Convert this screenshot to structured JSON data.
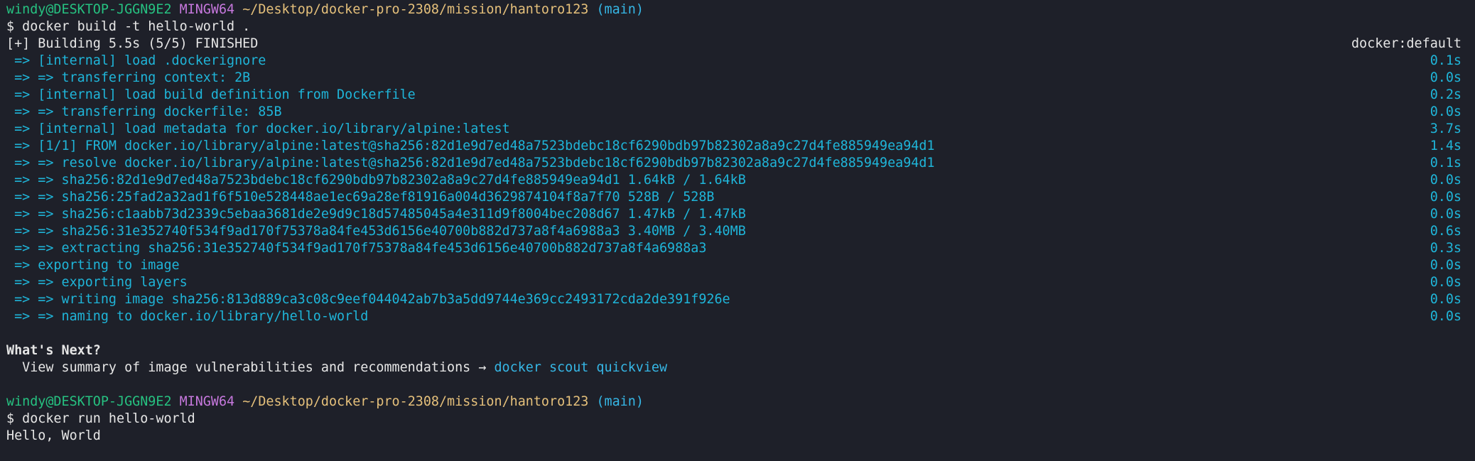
{
  "colors": {
    "background": "#1e2029",
    "user": "#26c281",
    "system": "#c678dd",
    "path": "#e5c07b",
    "branch": "#36b7e6",
    "step": "#1fb5d9",
    "text": "#e6e6e6"
  },
  "prompt1": {
    "user": "windy@DESKTOP-JGGN9E2",
    "system": "MINGW64",
    "path": "~/Desktop/docker-pro-2308/mission/hantoro123",
    "branch": "(main)"
  },
  "cmd1": "$ docker build -t hello-world .",
  "build_header": {
    "left": "[+] Building 5.5s (5/5) FINISHED",
    "right": "docker:default"
  },
  "steps": [
    {
      "text": " => [internal] load .dockerignore",
      "time": "0.1s"
    },
    {
      "text": " => => transferring context: 2B",
      "time": "0.0s"
    },
    {
      "text": " => [internal] load build definition from Dockerfile",
      "time": "0.2s"
    },
    {
      "text": " => => transferring dockerfile: 85B",
      "time": "0.0s"
    },
    {
      "text": " => [internal] load metadata for docker.io/library/alpine:latest",
      "time": "3.7s"
    },
    {
      "text": " => [1/1] FROM docker.io/library/alpine:latest@sha256:82d1e9d7ed48a7523bdebc18cf6290bdb97b82302a8a9c27d4fe885949ea94d1",
      "time": "1.4s"
    },
    {
      "text": " => => resolve docker.io/library/alpine:latest@sha256:82d1e9d7ed48a7523bdebc18cf6290bdb97b82302a8a9c27d4fe885949ea94d1",
      "time": "0.1s"
    },
    {
      "text": " => => sha256:82d1e9d7ed48a7523bdebc18cf6290bdb97b82302a8a9c27d4fe885949ea94d1 1.64kB / 1.64kB",
      "time": "0.0s"
    },
    {
      "text": " => => sha256:25fad2a32ad1f6f510e528448ae1ec69a28ef81916a004d3629874104f8a7f70 528B / 528B",
      "time": "0.0s"
    },
    {
      "text": " => => sha256:c1aabb73d2339c5ebaa3681de2e9d9c18d57485045a4e311d9f8004bec208d67 1.47kB / 1.47kB",
      "time": "0.0s"
    },
    {
      "text": " => => sha256:31e352740f534f9ad170f75378a84fe453d6156e40700b882d737a8f4a6988a3 3.40MB / 3.40MB",
      "time": "0.6s"
    },
    {
      "text": " => => extracting sha256:31e352740f534f9ad170f75378a84fe453d6156e40700b882d737a8f4a6988a3",
      "time": "0.3s"
    },
    {
      "text": " => exporting to image",
      "time": "0.0s"
    },
    {
      "text": " => => exporting layers",
      "time": "0.0s"
    },
    {
      "text": " => => writing image sha256:813d889ca3c08c9eef044042ab7b3a5dd9744e369cc2493172cda2de391f926e",
      "time": "0.0s"
    },
    {
      "text": " => => naming to docker.io/library/hello-world",
      "time": "0.0s"
    }
  ],
  "whats_next": {
    "heading": "What's Next?",
    "text": "  View summary of image vulnerabilities and recommendations → ",
    "link": "docker scout quickview"
  },
  "prompt2": {
    "user": "windy@DESKTOP-JGGN9E2",
    "system": "MINGW64",
    "path": "~/Desktop/docker-pro-2308/mission/hantoro123",
    "branch": "(main)"
  },
  "cmd2": "$ docker run hello-world",
  "output": "Hello, World"
}
